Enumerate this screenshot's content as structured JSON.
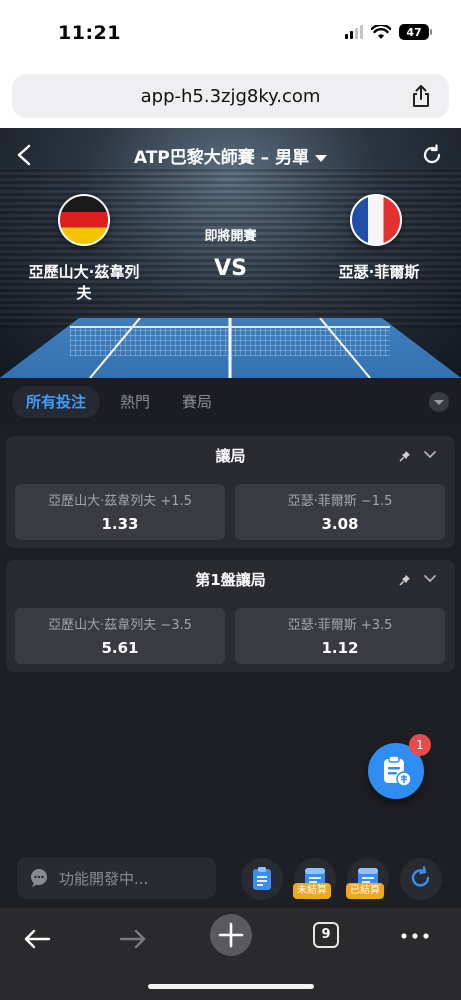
{
  "status_bar": {
    "time": "11:21",
    "battery": "47"
  },
  "browser": {
    "url": "app-h5.3zjg8ky.com",
    "tab_count": "9"
  },
  "match": {
    "title": "ATP巴黎大師賽 – 男單",
    "status": "即將開賽",
    "vs": "VS",
    "home": {
      "name": "亞歷山大·茲韋列夫",
      "flag": "germany-flag-icon"
    },
    "away": {
      "name": "亞瑟·菲爾斯",
      "flag": "france-flag-icon"
    }
  },
  "tabs": [
    {
      "label": "所有投注",
      "active": true
    },
    {
      "label": "熱門",
      "active": false
    },
    {
      "label": "賽局",
      "active": false
    }
  ],
  "markets": [
    {
      "title": "讓局",
      "outcomes": [
        {
          "label": "亞歷山大·茲韋列夫 +1.5",
          "odds": "1.33"
        },
        {
          "label": "亞瑟·菲爾斯 −1.5",
          "odds": "3.08"
        }
      ]
    },
    {
      "title": "第1盤讓局",
      "outcomes": [
        {
          "label": "亞歷山大·茲韋列夫 −3.5",
          "odds": "5.61"
        },
        {
          "label": "亞瑟·菲爾斯 +3.5",
          "odds": "1.12"
        }
      ]
    }
  ],
  "betslip": {
    "badge": "1"
  },
  "bottom_bar": {
    "chat_placeholder": "功能開發中...",
    "unsettled_label": "未結算",
    "settled_label": "已結算"
  },
  "colors": {
    "accent": "#3aa0ff",
    "badge": "#e94a4a",
    "tag": "#f0a81c"
  }
}
